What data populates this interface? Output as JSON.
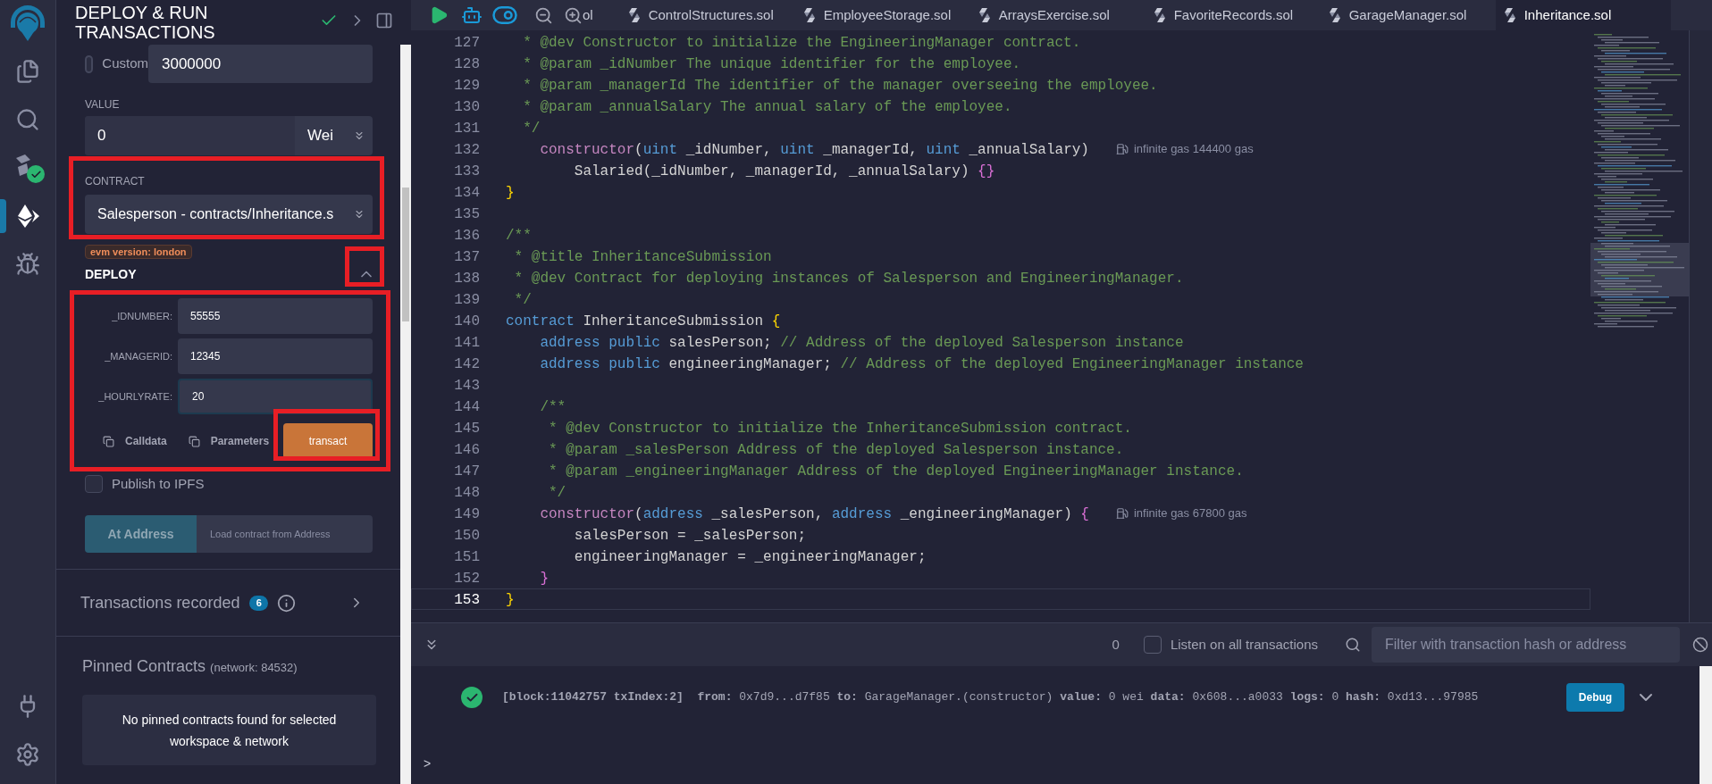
{
  "rail": {
    "top": [
      {
        "kind": "files",
        "selected": false
      },
      {
        "kind": "search",
        "selected": false
      },
      {
        "kind": "compiler",
        "selected": false,
        "compiled": true
      },
      {
        "kind": "deploy",
        "selected": true
      },
      {
        "kind": "debugger",
        "selected": false
      }
    ],
    "bottom": [
      {
        "kind": "plugins",
        "selected": false
      },
      {
        "kind": "settings",
        "selected": false
      }
    ]
  },
  "panel": {
    "title": "DEPLOY & RUN TRANSACTIONS",
    "gas": {
      "label": "Custom",
      "selected": false,
      "value": "3000000"
    },
    "value": {
      "label": "VALUE",
      "value": "0",
      "unit": "Wei"
    },
    "contract": {
      "label": "CONTRACT",
      "value": "Salesperson - contracts/Inheritance.s",
      "badge": "evm version: london"
    },
    "deploy": {
      "title": "DEPLOY",
      "expanded": true,
      "params": [
        {
          "label": "_IDNUMBER:",
          "value": "55555",
          "focused": false
        },
        {
          "label": "_MANAGERID:",
          "value": "12345",
          "focused": false
        },
        {
          "label": "_HOURLYRATE:",
          "value": "20",
          "focused": true
        }
      ],
      "actions": [
        "Calldata",
        "Parameters"
      ],
      "button": "transact"
    },
    "publish": {
      "label": "Publish to IPFS",
      "checked": false
    },
    "at_address": {
      "button": "At Address",
      "placeholder": "Load contract from Address"
    },
    "transactions": {
      "label": "Transactions recorded",
      "count": "6"
    },
    "pinned": {
      "title": "Pinned Contracts",
      "network": "(network: 84532)",
      "empty_message": "No pinned contracts found for selected workspace & network"
    }
  },
  "tabs": [
    {
      "label": "ol",
      "selected": false
    },
    {
      "label": "ControlStructures.sol",
      "selected": false
    },
    {
      "label": "EmployeeStorage.sol",
      "selected": false
    },
    {
      "label": "ArraysExercise.sol",
      "selected": false
    },
    {
      "label": "FavoriteRecords.sol",
      "selected": false
    },
    {
      "label": "GarageManager.sol",
      "selected": false
    },
    {
      "label": "Inheritance.sol",
      "selected": true
    }
  ],
  "code": [
    {
      "number": "127",
      "selected": false,
      "segments": [
        {
          "text": "  * @dev Constructor to initialize the EngineeringManager contract.",
          "kind": "comment"
        }
      ]
    },
    {
      "number": "128",
      "selected": false,
      "segments": [
        {
          "text": "  * @param _idNumber The unique identifier for the employee.",
          "kind": "comment"
        }
      ]
    },
    {
      "number": "129",
      "selected": false,
      "segments": [
        {
          "text": "  * @param _managerId The identifier of the manager overseeing the employee.",
          "kind": "comment"
        }
      ]
    },
    {
      "number": "130",
      "selected": false,
      "segments": [
        {
          "text": "  * @param _annualSalary The annual salary of the employee.",
          "kind": "comment"
        }
      ]
    },
    {
      "number": "131",
      "selected": false,
      "segments": [
        {
          "text": "  */",
          "kind": "comment"
        }
      ]
    },
    {
      "number": "132",
      "selected": false,
      "segments": [
        {
          "text": "    constructor",
          "kind": "declare"
        },
        {
          "text": "(",
          "kind": "plain"
        },
        {
          "text": "uint",
          "kind": "keyword"
        },
        {
          "text": " _idNumber, ",
          "kind": "plain"
        },
        {
          "text": "uint",
          "kind": "keyword"
        },
        {
          "text": " _managerId, ",
          "kind": "plain"
        },
        {
          "text": "uint",
          "kind": "keyword"
        },
        {
          "text": " _annualSalary)",
          "kind": "plain"
        }
      ],
      "hint": "infinite gas 144400 gas"
    },
    {
      "number": "133",
      "selected": false,
      "segments": [
        {
          "text": "        Salaried(_idNumber, _managerId, _annualSalary) ",
          "kind": "plain"
        },
        {
          "text": "{}",
          "kind": "bracket_orchid"
        }
      ]
    },
    {
      "number": "134",
      "selected": false,
      "segments": [
        {
          "text": "}",
          "kind": "bracket_gold"
        }
      ]
    },
    {
      "number": "135",
      "selected": false
    },
    {
      "number": "136",
      "selected": false,
      "segments": [
        {
          "text": "/**",
          "kind": "comment"
        }
      ]
    },
    {
      "number": "137",
      "selected": false,
      "segments": [
        {
          "text": " * @title InheritanceSubmission",
          "kind": "comment"
        }
      ]
    },
    {
      "number": "138",
      "selected": false,
      "segments": [
        {
          "text": " * @dev Contract for deploying instances of Salesperson and EngineeringManager.",
          "kind": "comment"
        }
      ]
    },
    {
      "number": "139",
      "selected": false,
      "segments": [
        {
          "text": " */",
          "kind": "comment"
        }
      ]
    },
    {
      "number": "140",
      "selected": false,
      "segments": [
        {
          "text": "contract",
          "kind": "keyword"
        },
        {
          "text": " InheritanceSubmission ",
          "kind": "plain"
        },
        {
          "text": "{",
          "kind": "bracket_gold"
        }
      ]
    },
    {
      "number": "141",
      "selected": false,
      "segments": [
        {
          "text": "    address public",
          "kind": "keyword"
        },
        {
          "text": " salesPerson; ",
          "kind": "plain"
        },
        {
          "text": "// Address of the deployed Salesperson instance",
          "kind": "comment"
        }
      ]
    },
    {
      "number": "142",
      "selected": false,
      "segments": [
        {
          "text": "    address public",
          "kind": "keyword"
        },
        {
          "text": " engineeringManager; ",
          "kind": "plain"
        },
        {
          "text": "// Address of the deployed EngineeringManager instance",
          "kind": "comment"
        }
      ]
    },
    {
      "number": "143",
      "selected": false
    },
    {
      "number": "144",
      "selected": false,
      "segments": [
        {
          "text": "    /**",
          "kind": "comment"
        }
      ]
    },
    {
      "number": "145",
      "selected": false,
      "segments": [
        {
          "text": "     * @dev Constructor to initialize the InheritanceSubmission contract.",
          "kind": "comment"
        }
      ]
    },
    {
      "number": "146",
      "selected": false,
      "segments": [
        {
          "text": "     * @param _salesPerson Address of the deployed Salesperson instance.",
          "kind": "comment"
        }
      ]
    },
    {
      "number": "147",
      "selected": false,
      "segments": [
        {
          "text": "     * @param _engineeringManager Address of the deployed EngineeringManager instance.",
          "kind": "comment"
        }
      ]
    },
    {
      "number": "148",
      "selected": false,
      "segments": [
        {
          "text": "     */",
          "kind": "comment"
        }
      ]
    },
    {
      "number": "149",
      "selected": false,
      "segments": [
        {
          "text": "    constructor",
          "kind": "declare"
        },
        {
          "text": "(",
          "kind": "plain"
        },
        {
          "text": "address",
          "kind": "keyword"
        },
        {
          "text": " _salesPerson, ",
          "kind": "plain"
        },
        {
          "text": "address",
          "kind": "keyword"
        },
        {
          "text": " _engineeringManager) ",
          "kind": "plain"
        },
        {
          "text": "{",
          "kind": "bracket_orchid"
        }
      ],
      "hint": "infinite gas 67800 gas"
    },
    {
      "number": "150",
      "selected": false,
      "segments": [
        {
          "text": "        salesPerson = _salesPerson;",
          "kind": "plain"
        }
      ]
    },
    {
      "number": "151",
      "selected": false,
      "segments": [
        {
          "text": "        engineeringManager = _engineeringManager;",
          "kind": "plain"
        }
      ]
    },
    {
      "number": "152",
      "selected": false,
      "segments": [
        {
          "text": "    }",
          "kind": "bracket_orchid"
        }
      ]
    },
    {
      "number": "153",
      "selected": true,
      "segments": [
        {
          "text": "}",
          "kind": "bracket_gold"
        }
      ]
    }
  ],
  "terminal": {
    "count": "0",
    "listen": {
      "label": "Listen on all transactions",
      "checked": false
    },
    "filter_placeholder": "Filter with transaction hash or address",
    "logs": [
      {
        "succeeded": true,
        "text": "**[block:11042757 txIndex:2]**  **from:** 0x7d9...d7f85 **to:** GarageManager.(constructor) **value:** 0 wei **data:** 0x608...a0033 **logs:** 0 **hash:** 0xd13...97985",
        "button": "Debug"
      }
    ],
    "prompt": ">"
  }
}
